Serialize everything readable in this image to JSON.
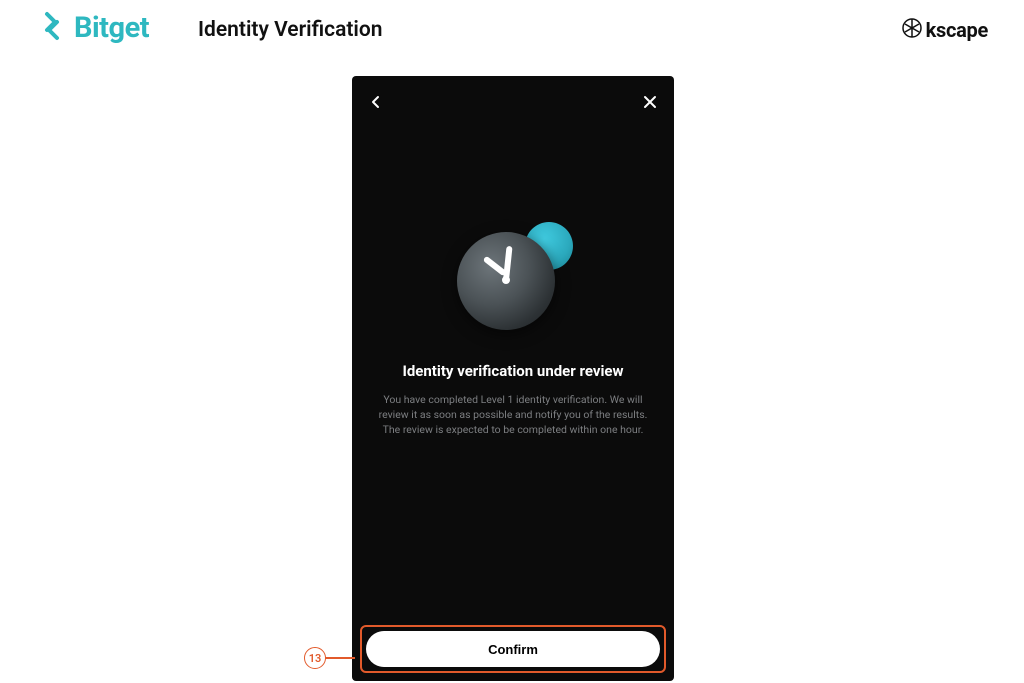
{
  "header": {
    "logo_text": "Bitget",
    "page_title": "Identity Verification",
    "right_brand": "kscape"
  },
  "colors": {
    "accent_teal": "#2eb8c0",
    "highlight_orange": "#e25a2b"
  },
  "phone": {
    "heading": "Identity verification under review",
    "body": "You have completed Level 1 identity verification. We will review it as soon as possible and notify you of the results. The review is expected to be completed within one hour.",
    "confirm_label": "Confirm"
  },
  "annotation": {
    "step_number": "13"
  }
}
